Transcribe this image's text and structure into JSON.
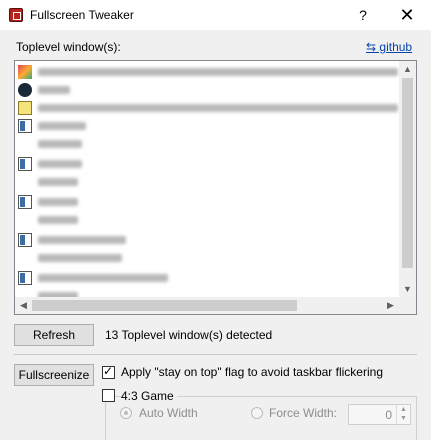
{
  "window": {
    "title": "Fullscreen Tweaker",
    "help": "?",
    "close": "✕"
  },
  "list": {
    "label": "Toplevel window(s):",
    "link": "⇆ github",
    "items": [
      {
        "icon": "image-app-icon"
      },
      {
        "icon": "steam-icon"
      },
      {
        "icon": "notepad-icon"
      },
      {
        "icon": "window-icon"
      },
      {
        "icon": ""
      },
      {
        "icon": "window-icon"
      },
      {
        "icon": ""
      },
      {
        "icon": "window-icon"
      },
      {
        "icon": ""
      },
      {
        "icon": "window-icon"
      },
      {
        "icon": ""
      },
      {
        "icon": "window-icon"
      },
      {
        "icon": ""
      }
    ]
  },
  "refresh_label": "Refresh",
  "status": "13 Toplevel window(s) detected",
  "fullscreenize_label": "Fullscreenize",
  "stay_on_top": {
    "label": "Apply \"stay on top\" flag to avoid taskbar flickering",
    "checked": true
  },
  "game43": {
    "label": "4:3 Game",
    "checked": false
  },
  "auto_width_label": "Auto Width",
  "force_width_label": "Force Width:",
  "force_width_value": "0"
}
